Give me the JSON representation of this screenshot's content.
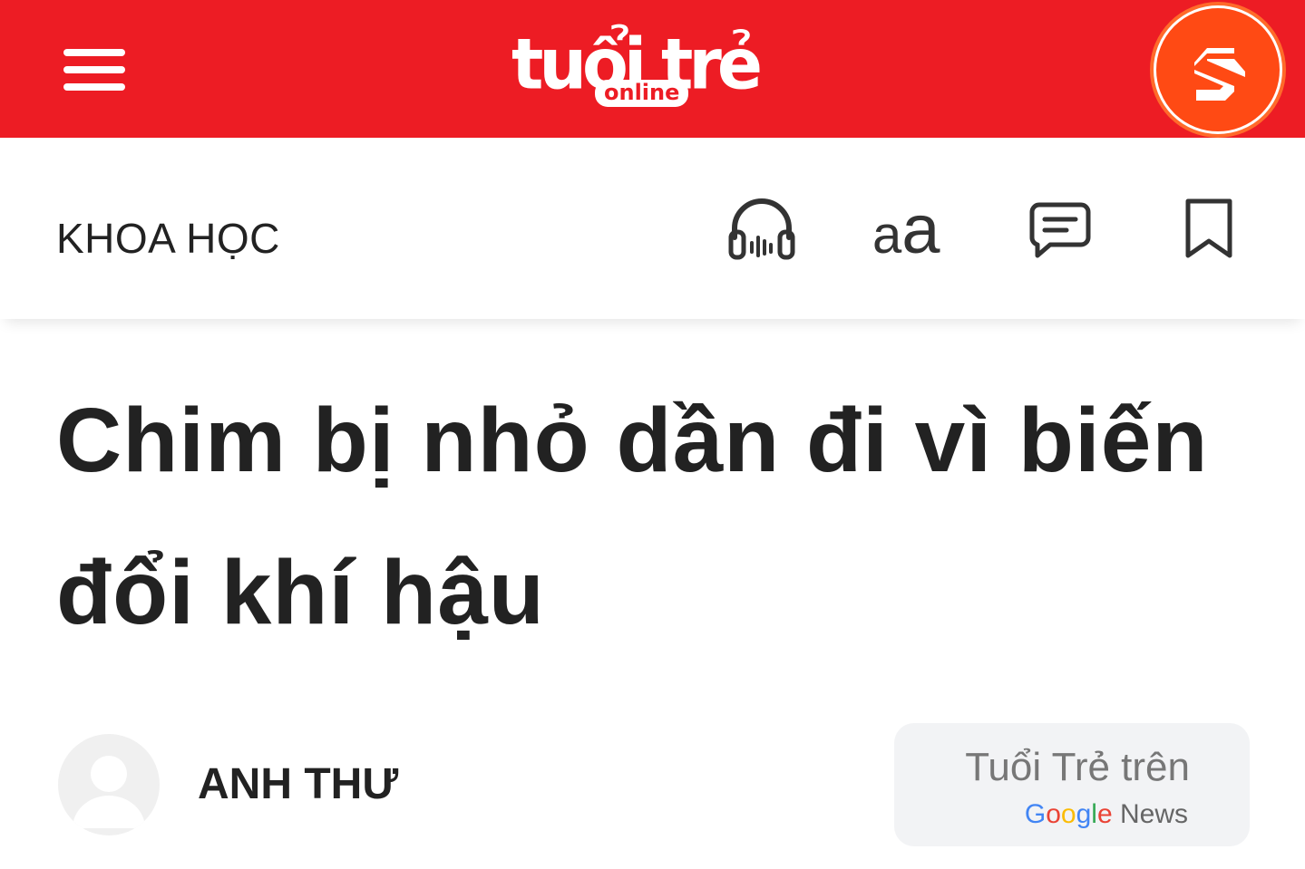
{
  "header": {
    "logo_main": "tuổi trẻ",
    "logo_sub": "online",
    "menu_icon": "hamburger-menu-icon",
    "badge_icon": "s-logo-icon",
    "colors": {
      "brand_red": "#ed1c24",
      "badge_orange": "#ff4a14"
    }
  },
  "toolbar": {
    "category": "KHOA HỌC",
    "audio_icon": "headphones-icon",
    "font_size_small": "a",
    "font_size_large": "a",
    "comment_icon": "comment-icon",
    "bookmark_icon": "bookmark-icon"
  },
  "article": {
    "title": "Chim bị nhỏ dần đi vì biến đổi khí hậu",
    "author": "ANH THƯ",
    "avatar_icon": "user-avatar-icon"
  },
  "google_news": {
    "label": "Tuổi Trẻ trên",
    "letters": [
      "G",
      "o",
      "o",
      "g",
      "l",
      "e"
    ],
    "news": "News",
    "colors": [
      "#4285f4",
      "#ea4335",
      "#fbbc05",
      "#4285f4",
      "#34a853",
      "#ea4335"
    ]
  }
}
